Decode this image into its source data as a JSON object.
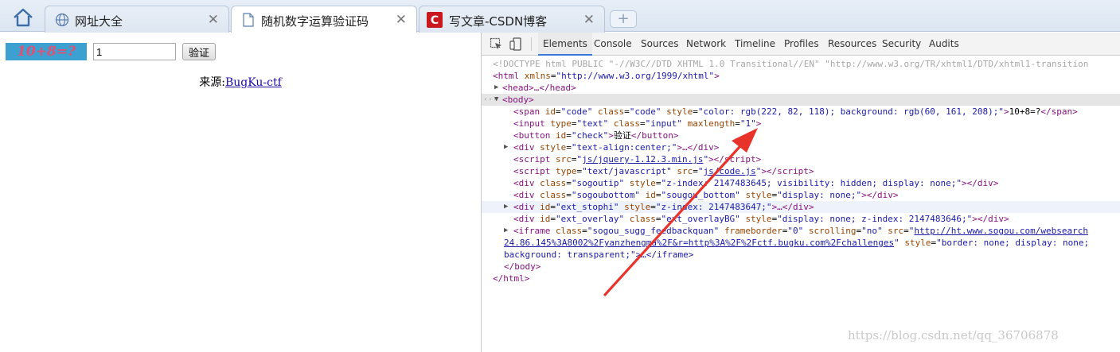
{
  "tabs": [
    {
      "label": "网址大全",
      "icon": "globe-icon",
      "active": false
    },
    {
      "label": "随机数字运算验证码",
      "icon": "page-icon",
      "active": true
    },
    {
      "label": "写文章-CSDN博客",
      "icon": "csdn-icon",
      "active": false
    }
  ],
  "new_tab_symbol": "+",
  "page": {
    "captcha_text": "10+8=?",
    "input_value": "1",
    "verify_label": "验证",
    "source_prefix": "来源:",
    "source_link": "BugKu-ctf"
  },
  "devtools": {
    "tabs": [
      "Elements",
      "Console",
      "Sources",
      "Network",
      "Timeline",
      "Profiles",
      "Resources",
      "Security",
      "Audits"
    ],
    "active_tab": "Elements"
  },
  "dom_lines": {
    "doctype": "<!DOCTYPE html PUBLIC \"-//W3C//DTD XHTML 1.0 Transitional//EN\" \"http://www.w3.org/TR/xhtml1/DTD/xhtml1-transition",
    "html_open_tag": "html",
    "html_attr": "xmlns",
    "html_val": "\"http://www.w3.org/1999/xhtml\"",
    "head": "<head>…</head>",
    "body_open": "<body>",
    "span_attrs": [
      "id",
      "\"code\"",
      "class",
      "\"code\"",
      "style",
      "\"color: rgb(222, 82, 118); background: rgb(60, 161, 208);\""
    ],
    "span_text": "10+8=?",
    "input_attrs": [
      "type",
      "\"text\"",
      "class",
      "\"input\"",
      "maxlength",
      "\"1\""
    ],
    "button_attrs": [
      "id",
      "\"check\""
    ],
    "button_text": "验证",
    "div_center": [
      "style",
      "\"text-align:center;\""
    ],
    "script1": [
      "src",
      "js/jquery-1.12.3.min.js"
    ],
    "script2": [
      "type",
      "\"text/javascript\"",
      "src",
      "js/code.js"
    ],
    "sogoutip": [
      "class",
      "\"sogoutip\"",
      "style",
      "\"z-index: 2147483645; visibility: hidden; display: none;\""
    ],
    "sogoubottom": [
      "class",
      "\"sogoubottom\"",
      "id",
      "\"sougou_bottom\"",
      "style",
      "\"display: none;\""
    ],
    "ext_stophi": [
      "id",
      "\"ext_stophi\"",
      "style",
      "\"z-index: 2147483647;\""
    ],
    "ext_overlay": [
      "id",
      "\"ext_overlay\"",
      "class",
      "\"ext_overlayBG\"",
      "style",
      "\"display: none; z-index: 2147483646;\""
    ],
    "iframe_attrs": [
      "class",
      "\"sogou_sugg_feedbackquan\"",
      "frameborder",
      "\"0\"",
      "scrolling",
      "\"no\"",
      "src"
    ],
    "iframe_url1": "http://ht.www.sogou.com/websearch",
    "iframe_url2": "24.86.145%3A8002%2Fyanzhengma%2F&r=http%3A%2F%2Fctf.bugku.com%2Fchallenges",
    "iframe_style_attr": "style",
    "iframe_style_val": "\"border: none; display: none;",
    "iframe_style_cont": "background: transparent;\">…</iframe>",
    "body_close": "</body>",
    "html_close": "</html>"
  },
  "watermark": "https://blog.csdn.net/qq_36706878",
  "colors": {
    "captcha_fg": "#de5276",
    "captcha_bg": "#3ca1d0",
    "arrow": "#e8332a"
  }
}
